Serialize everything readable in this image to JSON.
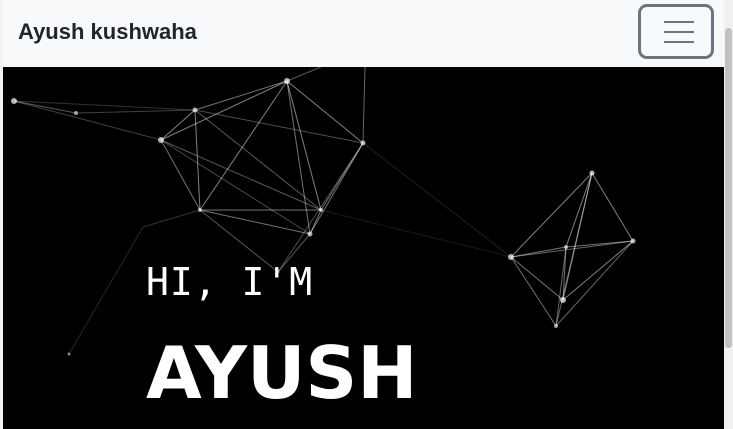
{
  "navbar": {
    "brand": "Ayush kushwaha",
    "toggler_icon": "hamburger-menu-icon"
  },
  "hero": {
    "greeting": "HI, I'M",
    "name": "AYUSH",
    "background_color": "#000000",
    "text_color": "#ffffff",
    "network_color": "#ffffff"
  }
}
